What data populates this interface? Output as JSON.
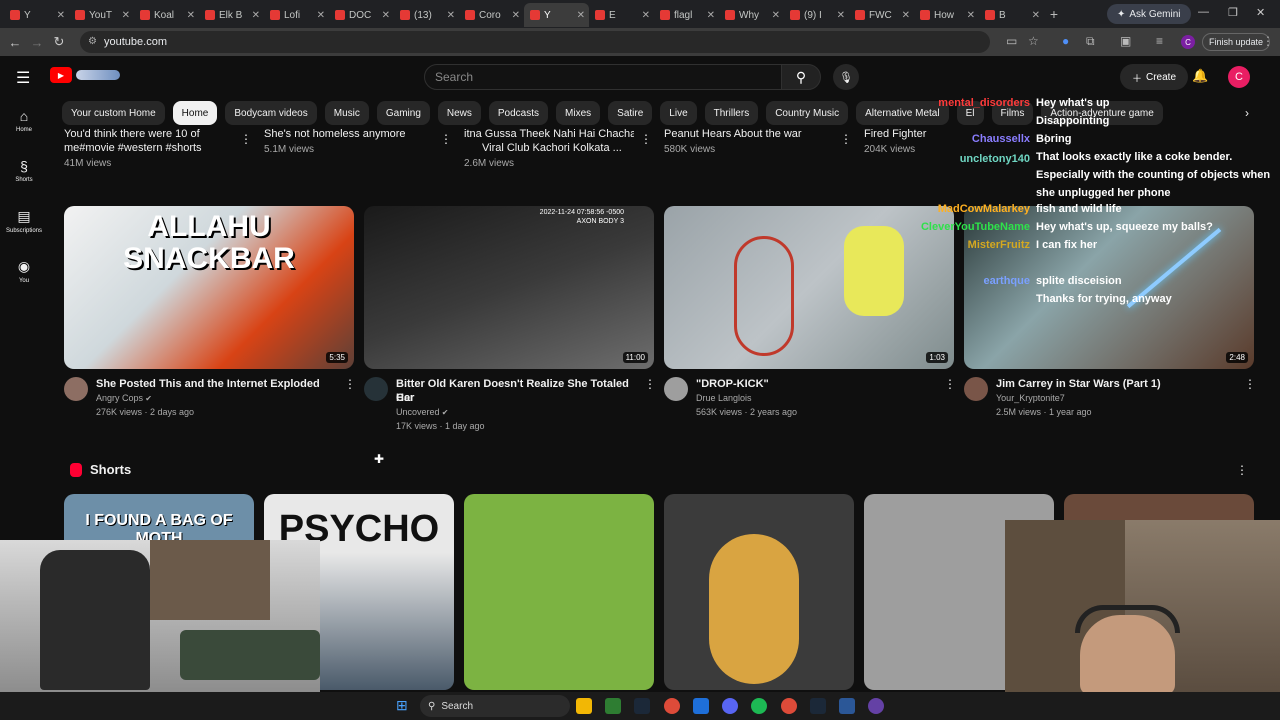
{
  "browser": {
    "tabs": [
      {
        "label": "Y"
      },
      {
        "label": "YouT"
      },
      {
        "label": "Koal"
      },
      {
        "label": "Elk B"
      },
      {
        "label": "Lofi"
      },
      {
        "label": "DOC"
      },
      {
        "label": "(13)"
      },
      {
        "label": "Coro"
      },
      {
        "label": "Y"
      },
      {
        "label": "E"
      },
      {
        "label": "flagl"
      },
      {
        "label": "Why"
      },
      {
        "label": "(9) I"
      },
      {
        "label": "FWC"
      },
      {
        "label": "How"
      },
      {
        "label": "B"
      }
    ],
    "active_tab_index": 8,
    "ask_gemini": "Ask Gemini",
    "url": "youtube.com",
    "finish_update": "Finish update",
    "profile_initial": "C"
  },
  "youtube": {
    "search_placeholder": "Search",
    "create_label": "Create",
    "avatar_initial": "C",
    "sidebar": [
      {
        "label": "Home",
        "icon": "home-icon"
      },
      {
        "label": "Shorts",
        "icon": "shorts-icon"
      },
      {
        "label": "Subscriptions",
        "icon": "subscriptions-icon"
      },
      {
        "label": "You",
        "icon": "you-icon"
      }
    ],
    "chips": [
      "Your custom Home",
      "Home",
      "Bodycam videos",
      "Music",
      "Gaming",
      "News",
      "Podcasts",
      "Mixes",
      "Satire",
      "Live",
      "Thrillers",
      "Country Music",
      "Alternative Metal",
      "El",
      "Films",
      "Action-adventure game"
    ],
    "top_row": [
      {
        "title1": "You'd think there were 10 of",
        "title2": "me#movie #western #shorts",
        "meta": "41M views"
      },
      {
        "title1": "She's not homeless anymore",
        "title2": "",
        "meta": "5.1M views"
      },
      {
        "title1": "itna Gussa Theek Nahi Hai Chacha",
        "title2": "Viral Club Kachori Kolkata ...",
        "meta": "2.6M views"
      },
      {
        "title1": "Peanut Hears About the war",
        "title2": "",
        "meta": "580K views"
      },
      {
        "title1": "Fired Fighter",
        "title2": "",
        "meta": "204K views"
      }
    ],
    "videos": [
      {
        "title1": "She Posted This and the Internet Exploded",
        "title2": "",
        "channel": "Angry Cops",
        "meta": "276K views · 2 days ago",
        "duration": "5:35",
        "thumb_text1": "ALLAHU",
        "thumb_text2": "SNACKBAR"
      },
      {
        "title1": "Bitter Old Karen Doesn't Realize She Totaled Her",
        "title2": "Car",
        "channel": "Uncovered",
        "meta": "17K views · 1 day ago",
        "duration": "11:00",
        "thumb_text1": "2022-11-24 07:58:56 -0500",
        "thumb_text2": "AXON BODY 3"
      },
      {
        "title1": "\"DROP-KICK\"",
        "title2": "",
        "channel": "Drue Langlois",
        "meta": "563K views · 2 years ago",
        "duration": "1:03",
        "thumb_text1": "",
        "thumb_text2": ""
      },
      {
        "title1": "Jim Carrey in Star Wars (Part 1)",
        "title2": "",
        "channel": "Your_Kryptonite7",
        "meta": "2.5M views · 1 year ago",
        "duration": "2:48",
        "thumb_text1": "",
        "thumb_text2": ""
      }
    ],
    "shorts_title": "Shorts",
    "shorts": [
      {
        "text": "I FOUND A BAG OF MOTH"
      },
      {
        "text": "PSYCHO"
      },
      {
        "text": ""
      },
      {
        "text": ""
      },
      {
        "text": ""
      },
      {
        "text": ""
      }
    ]
  },
  "chat": [
    {
      "user": "mental_disorders",
      "text": "Hey what's up",
      "color": "#ff3b3b"
    },
    {
      "user": "",
      "text": "Disappointing",
      "color": "#ff5c5c"
    },
    {
      "user": "Chaussellx",
      "text": "Boring",
      "color": "#8a7dff"
    },
    {
      "user": "",
      "text": "That looks exactly like a coke bender.",
      "color": "#ffffff"
    },
    {
      "user": "uncletony140",
      "text": "",
      "color": "#6fd6c2"
    },
    {
      "user": "",
      "text": "Especially with the counting of objects when",
      "color": "#ffffff"
    },
    {
      "user": "",
      "text": "she unplugged her phone",
      "color": "#ffffff"
    },
    {
      "user": "MadCowMalarkey",
      "text": "fish and wild life",
      "color": "#ffb020"
    },
    {
      "user": "CleverYouTubeName",
      "text": "Hey what's up, squeeze my balls?",
      "color": "#2ee24a"
    },
    {
      "user": "MisterFruitz",
      "text": "I can fix her",
      "color": "#d4a820"
    },
    {
      "user": "",
      "text": "",
      "color": "#5a5ad8"
    },
    {
      "user": "earthque",
      "text": "splite disceision",
      "color": "#7aa0ff"
    },
    {
      "user": "",
      "text": "Thanks for trying, anyway",
      "color": "#8a5ad8"
    }
  ],
  "taskbar": {
    "search_label": "Search"
  }
}
